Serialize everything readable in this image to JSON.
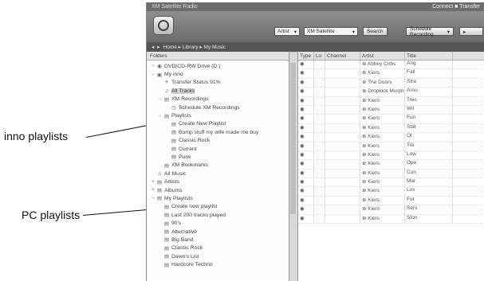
{
  "callouts": {
    "inno": "inno playlists",
    "pc": "PC playlists"
  },
  "app": {
    "title": "XM Satellite Radio",
    "title_right": "Connect ■ Transfer",
    "search_value": "Artist",
    "search_field": "XM Satellite",
    "search_button": "Search",
    "action_button": "Schedule Recording",
    "nav_path": "Home ▸ Library ▸ My Music"
  },
  "tree": {
    "header": "Folders",
    "nodes": [
      {
        "ex": "−",
        "icon": "◉",
        "label": "DVD/CD-RW Drive (D:)",
        "indent": 0
      },
      {
        "ex": "−",
        "icon": "▣",
        "label": "My inno",
        "indent": 0
      },
      {
        "ex": "",
        "icon": "≡",
        "label": "Transfer Status 91%",
        "indent": 1
      },
      {
        "ex": "",
        "icon": "♫",
        "label": "All Tracks",
        "indent": 1,
        "sel": true
      },
      {
        "ex": "−",
        "icon": "▤",
        "label": "XM Recordings",
        "indent": 1
      },
      {
        "ex": "",
        "icon": "◷",
        "label": "Schedule XM Recordings",
        "indent": 2
      },
      {
        "ex": "−",
        "icon": "▤",
        "label": "Playlists",
        "indent": 1
      },
      {
        "ex": "",
        "icon": "▤",
        "label": "Create New Playlist",
        "indent": 2
      },
      {
        "ex": "",
        "icon": "▤",
        "label": "Bump stuff my wife made me buy",
        "indent": 2
      },
      {
        "ex": "",
        "icon": "▤",
        "label": "Classic Rock",
        "indent": 2
      },
      {
        "ex": "",
        "icon": "▤",
        "label": "Current",
        "indent": 2
      },
      {
        "ex": "",
        "icon": "▤",
        "label": "Punk",
        "indent": 2
      },
      {
        "ex": "",
        "icon": "▤",
        "label": "XM Bookmarks",
        "indent": 1
      },
      {
        "ex": "",
        "icon": "♫",
        "label": "All Music",
        "indent": 0
      },
      {
        "ex": "+",
        "icon": "▤",
        "label": "Artists",
        "indent": 0
      },
      {
        "ex": "+",
        "icon": "▤",
        "label": "Albums",
        "indent": 0
      },
      {
        "ex": "−",
        "icon": "▤",
        "label": "My Playlists",
        "indent": 0
      },
      {
        "ex": "",
        "icon": "▤",
        "label": "Create new playlist",
        "indent": 1
      },
      {
        "ex": "",
        "icon": "▤",
        "label": "Last 200 tracks played",
        "indent": 1
      },
      {
        "ex": "",
        "icon": "▤",
        "label": "90's",
        "indent": 1
      },
      {
        "ex": "",
        "icon": "▤",
        "label": "Alternative",
        "indent": 1
      },
      {
        "ex": "",
        "icon": "▤",
        "label": "Big Band",
        "indent": 1
      },
      {
        "ex": "",
        "icon": "▤",
        "label": "Classic Rock",
        "indent": 1
      },
      {
        "ex": "",
        "icon": "▤",
        "label": "Dawn's List",
        "indent": 1
      },
      {
        "ex": "",
        "icon": "▤",
        "label": "Hardcore Techno",
        "indent": 1
      }
    ]
  },
  "table": {
    "headers": [
      "Type",
      "Lo",
      "Channel",
      "Artist",
      "Title"
    ],
    "rows": [
      [
        "◉",
        "",
        "",
        "⊕ Abbey Cribs",
        "Ang"
      ],
      [
        "◉",
        "",
        "",
        "⊕ Kiers",
        "Fall"
      ],
      [
        "◉",
        "",
        "",
        "⊕ The Doors",
        "Stra"
      ],
      [
        "◉",
        "",
        "",
        "⊕ Dropkick Murphys",
        "Arou"
      ],
      [
        "◉",
        "",
        "",
        "⊕ Kiers",
        "Tres"
      ],
      [
        "◉",
        "",
        "",
        "⊕ Kiers",
        "Wil"
      ],
      [
        "◉",
        "",
        "",
        "⊕ Kiers",
        "Fun"
      ],
      [
        "◉",
        "",
        "",
        "⊕ Kiers",
        "Stat"
      ],
      [
        "◉",
        "",
        "",
        "⊕ Kiers",
        "Ol"
      ],
      [
        "◉",
        "",
        "",
        "⊕ Kiers",
        "Tre"
      ],
      [
        "◉",
        "",
        "",
        "⊕ Kiers",
        "Low"
      ],
      [
        "◉",
        "",
        "",
        "⊕ Kiers",
        "Ope"
      ],
      [
        "◉",
        "",
        "",
        "⊕ Kiers",
        "Cun"
      ],
      [
        "◉",
        "",
        "",
        "⊕ Kiers",
        "Mar"
      ],
      [
        "◉",
        "",
        "",
        "⊕ Kiers",
        "Lov"
      ],
      [
        "◉",
        "",
        "",
        "⊕ Kiers",
        "For"
      ],
      [
        "◉",
        "",
        "",
        "⊕ Kiers",
        "Serv"
      ],
      [
        "◉",
        "",
        "",
        "⊕ Kiers",
        "Ston"
      ]
    ]
  }
}
